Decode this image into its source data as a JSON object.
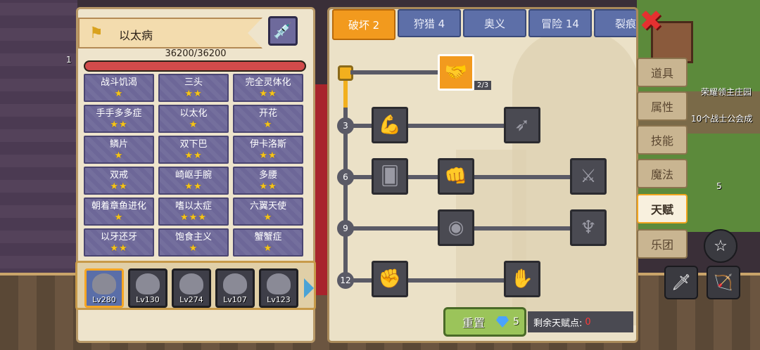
{
  "left_panel": {
    "title": "以太病",
    "hp_text": "36200/36200",
    "hp_fraction": 1.0,
    "traits": [
      {
        "name": "战斗饥渴",
        "stars": "★"
      },
      {
        "name": "三头",
        "stars": "★★"
      },
      {
        "name": "完全灵体化",
        "stars": "★★"
      },
      {
        "name": "手手多多症",
        "stars": "★★"
      },
      {
        "name": "以太化",
        "stars": "★"
      },
      {
        "name": "开花",
        "stars": "★"
      },
      {
        "name": "鳞片",
        "stars": "★"
      },
      {
        "name": "双下巴",
        "stars": "★★"
      },
      {
        "name": "伊卡洛斯",
        "stars": "★★"
      },
      {
        "name": "双戒",
        "stars": "★★"
      },
      {
        "name": "崎岖手腕",
        "stars": "★★"
      },
      {
        "name": "多腰",
        "stars": "★★"
      },
      {
        "name": "朝着章鱼进化",
        "stars": "★"
      },
      {
        "name": "嗜以太症",
        "stars": "★★★"
      },
      {
        "name": "六翼天使",
        "stars": "★"
      },
      {
        "name": "以牙还牙",
        "stars": "★★"
      },
      {
        "name": "饱食主义",
        "stars": "★"
      },
      {
        "name": "蟹蟹症",
        "stars": "★"
      }
    ],
    "heroes": [
      {
        "level": "Lv280"
      },
      {
        "level": "Lv130"
      },
      {
        "level": "Lv274"
      },
      {
        "level": "Lv107"
      },
      {
        "level": "Lv123"
      }
    ]
  },
  "right_panel": {
    "tabs": [
      "破坏 2",
      "狩猎 4",
      "奥义",
      "冒险 14",
      "裂痕"
    ],
    "top_talent_progress": "2/3",
    "tier_numbers": [
      "3",
      "6",
      "9",
      "12"
    ],
    "reset_label": "重置",
    "gem_count": "5",
    "remaining_label": "剩余天赋点:",
    "remaining_value": "0"
  },
  "side_tabs": [
    "道具",
    "属性",
    "技能",
    "魔法",
    "天赋",
    "乐团"
  ],
  "background": {
    "map_label_1": "荣耀领主庄园",
    "map_label_2": "10个战士公会成",
    "small_number": "5",
    "top_left_num": "1"
  },
  "icons": {
    "close": "close-icon",
    "syringe": "syringe-icon",
    "flag": "flag-icon",
    "gem": "gem-icon"
  },
  "colors": {
    "active_tab": "#f29a1e",
    "hp_bar": "#d24b4b",
    "star": "#f6c51a",
    "reset_button": "#9bc45a"
  }
}
